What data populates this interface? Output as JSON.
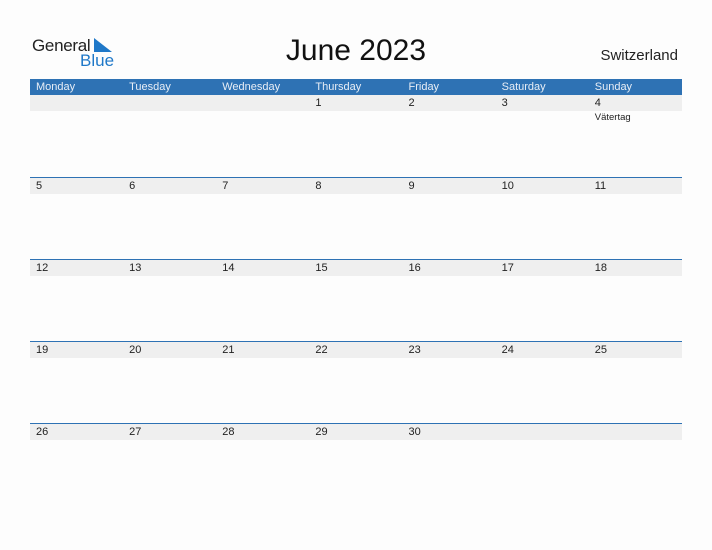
{
  "brand": {
    "general": "General",
    "blue": "Blue",
    "accent": "#1f78c8"
  },
  "title": "June 2023",
  "country": "Switzerland",
  "header_color": "#2e72b4",
  "weekdays": [
    "Monday",
    "Tuesday",
    "Wednesday",
    "Thursday",
    "Friday",
    "Saturday",
    "Sunday"
  ],
  "weeks": [
    [
      {
        "day": ""
      },
      {
        "day": ""
      },
      {
        "day": ""
      },
      {
        "day": "1"
      },
      {
        "day": "2"
      },
      {
        "day": "3"
      },
      {
        "day": "4",
        "event": "Vätertag"
      }
    ],
    [
      {
        "day": "5"
      },
      {
        "day": "6"
      },
      {
        "day": "7"
      },
      {
        "day": "8"
      },
      {
        "day": "9"
      },
      {
        "day": "10"
      },
      {
        "day": "11"
      }
    ],
    [
      {
        "day": "12"
      },
      {
        "day": "13"
      },
      {
        "day": "14"
      },
      {
        "day": "15"
      },
      {
        "day": "16"
      },
      {
        "day": "17"
      },
      {
        "day": "18"
      }
    ],
    [
      {
        "day": "19"
      },
      {
        "day": "20"
      },
      {
        "day": "21"
      },
      {
        "day": "22"
      },
      {
        "day": "23"
      },
      {
        "day": "24"
      },
      {
        "day": "25"
      }
    ],
    [
      {
        "day": "26"
      },
      {
        "day": "27"
      },
      {
        "day": "28"
      },
      {
        "day": "29"
      },
      {
        "day": "30"
      },
      {
        "day": ""
      },
      {
        "day": ""
      }
    ]
  ]
}
